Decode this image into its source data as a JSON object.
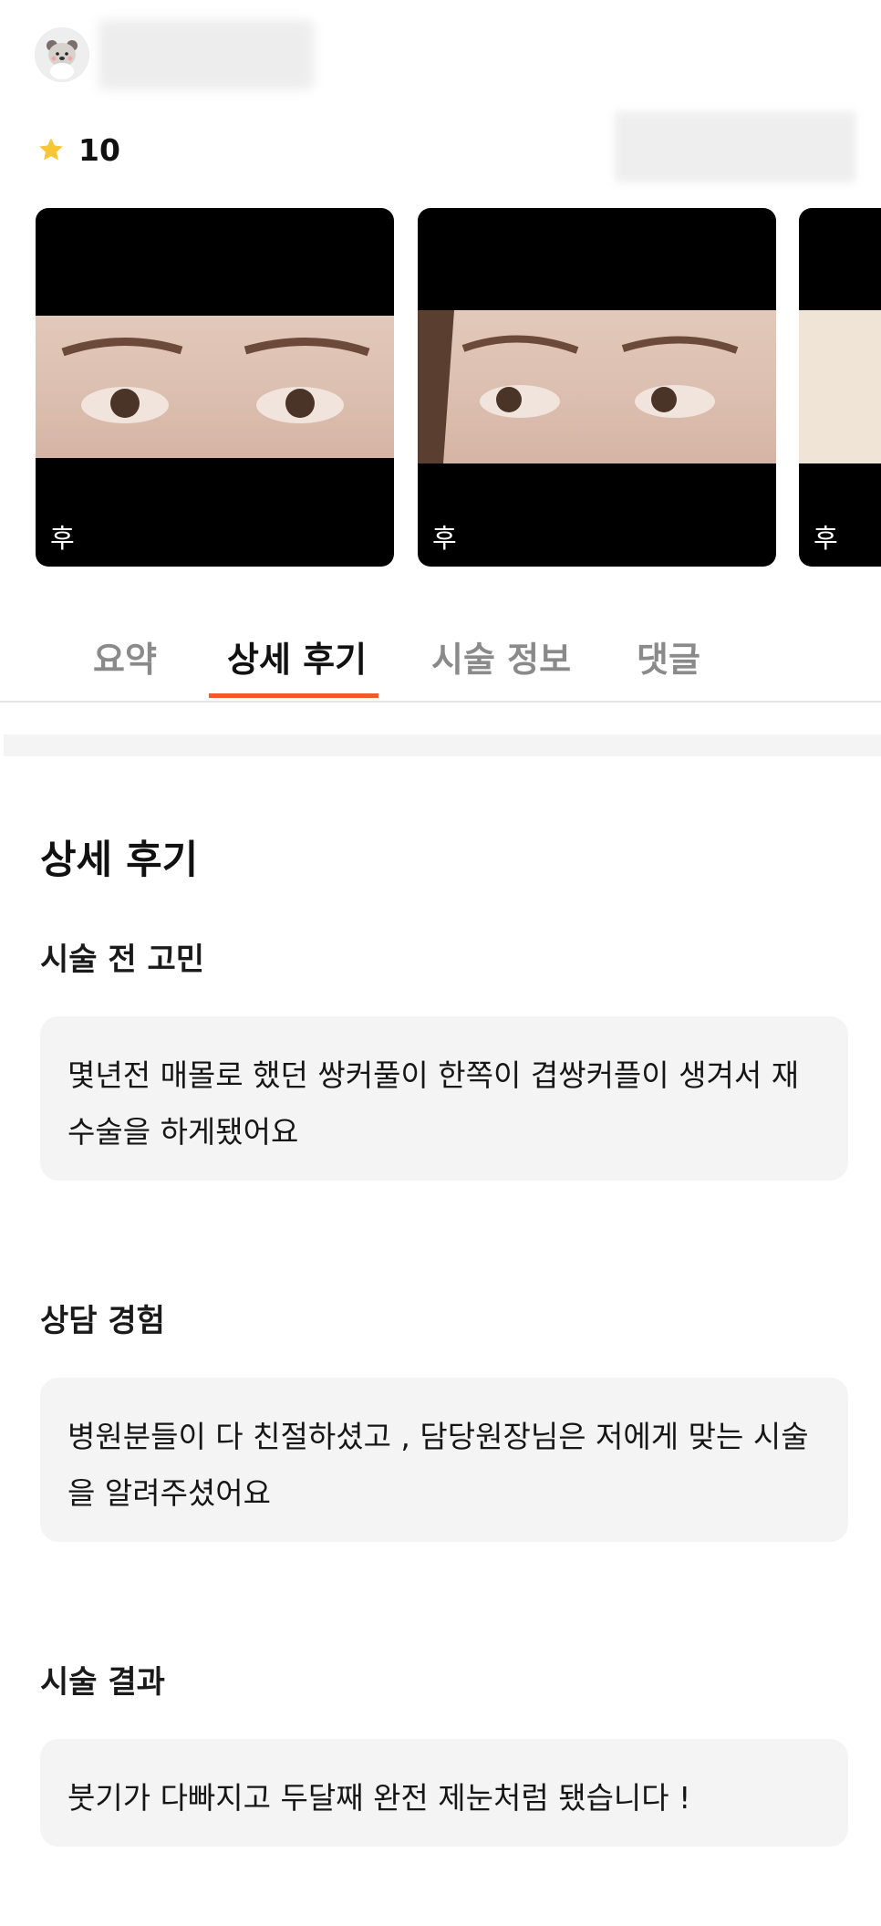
{
  "rating": {
    "value": "10"
  },
  "photos": [
    {
      "label": "후"
    },
    {
      "label": "후"
    },
    {
      "label": "후"
    }
  ],
  "tabs": [
    {
      "label": "요약",
      "active": false
    },
    {
      "label": "상세 후기",
      "active": true
    },
    {
      "label": "시술 정보",
      "active": false
    },
    {
      "label": "댓글",
      "active": false
    }
  ],
  "section": {
    "title": "상세 후기"
  },
  "qa": [
    {
      "question": "시술 전 고민",
      "answer": "몇년전 매몰로 했던 쌍커풀이 한쪽이 겹쌍커플이 생겨서 재수술을 하게됐어요"
    },
    {
      "question": "상담 경험",
      "answer": "병원분들이 다 친절하셨고 , 담당원장님은 저에게 맞는 시술을 알려주셨어요"
    },
    {
      "question": "시술 결과",
      "answer": "붓기가 다빠지고 두달째 완전 제눈처럼 됐습니다 !"
    }
  ],
  "colors": {
    "accent": "#f05a28",
    "star": "#f7c634",
    "box_bg": "#f4f4f4"
  },
  "icons": {
    "star": "star-icon",
    "avatar": "bear-avatar-icon"
  }
}
